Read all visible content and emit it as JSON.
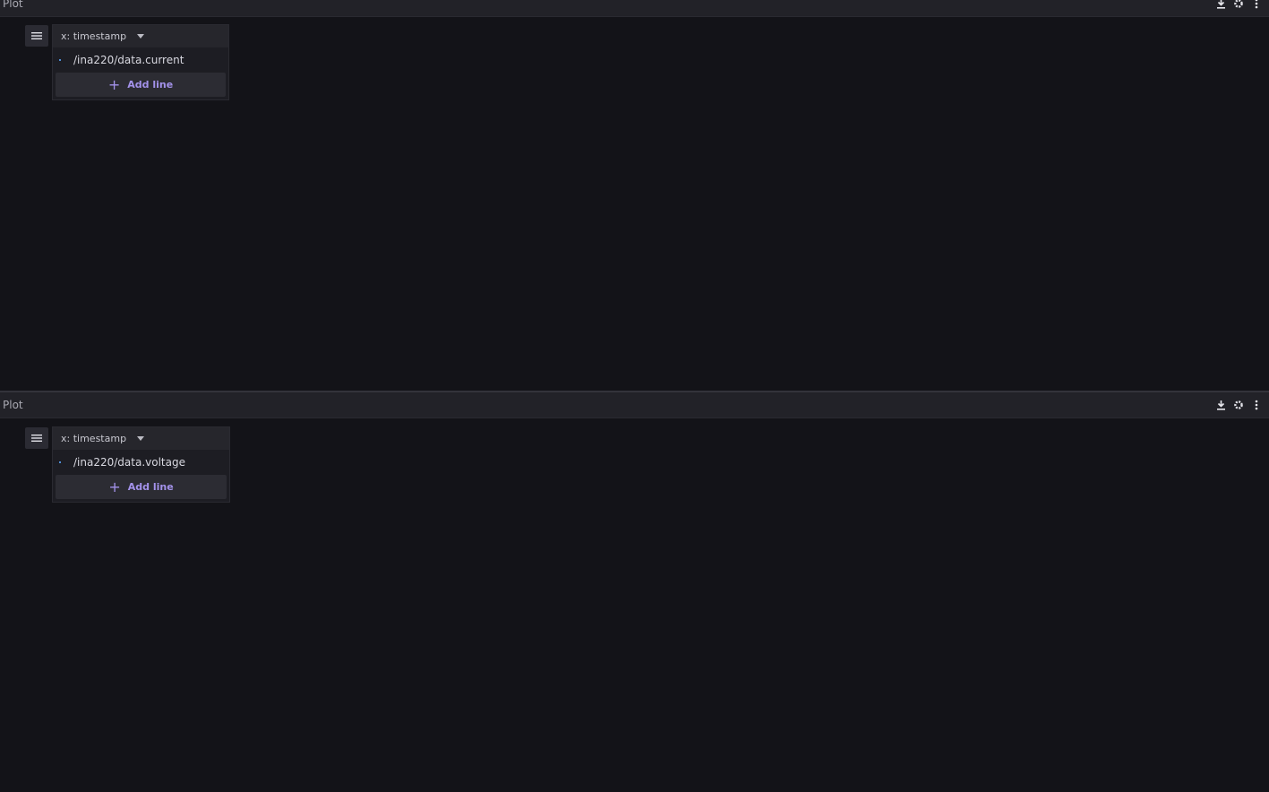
{
  "panels": [
    {
      "title": "Plot",
      "x_axis_label": "x: timestamp",
      "series": [
        {
          "name": "/ina220/data.current",
          "color": "#4f8fd8"
        }
      ],
      "add_line_label": "Add line"
    },
    {
      "title": "Plot",
      "x_axis_label": "x: timestamp",
      "series": [
        {
          "name": "/ina220/data.voltage",
          "color": "#4f8fd8"
        }
      ],
      "add_line_label": "Add line"
    }
  ],
  "icons": {
    "toolbar": [
      "download-icon",
      "settings-icon",
      "more-vertical-icon"
    ],
    "legend_toggle": "menu-icon",
    "add": "plus-icon"
  },
  "colors": {
    "background": "#131318",
    "toolbar": "#222228",
    "accent": "#a392ea",
    "series": "#4f8fd8"
  }
}
